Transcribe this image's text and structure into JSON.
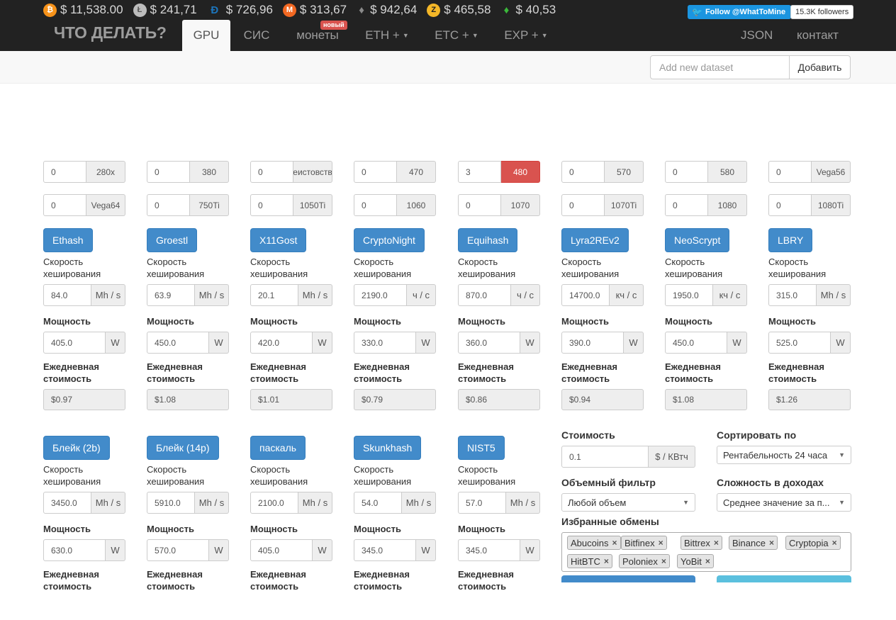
{
  "tickers": [
    {
      "icon": "bitcoin-icon",
      "cls": "btc",
      "glyph": "₿",
      "price": "$ 11,538.00"
    },
    {
      "icon": "litecoin-icon",
      "cls": "ltc",
      "glyph": "Ł",
      "price": "$ 241,71"
    },
    {
      "icon": "dash-icon",
      "cls": "dash",
      "glyph": "Đ",
      "price": "$ 726,96"
    },
    {
      "icon": "monero-icon",
      "cls": "xmr",
      "glyph": "M",
      "price": "$ 313,67"
    },
    {
      "icon": "ethereum-icon",
      "cls": "eth",
      "glyph": "♦",
      "price": "$ 942,64"
    },
    {
      "icon": "zcash-icon",
      "cls": "zec",
      "glyph": "Z",
      "price": "$ 465,58"
    },
    {
      "icon": "ethereum-classic-icon",
      "cls": "etc",
      "glyph": "♦",
      "price": "$ 40,53"
    }
  ],
  "twitter": {
    "follow_label": "Follow @WhatToMine",
    "followers": "15.3K followers"
  },
  "brand": "ЧТО ДЕЛАТЬ?",
  "nav": {
    "gpu": "GPU",
    "cis": "СИС",
    "coins": "монеты",
    "new_badge": "новый",
    "eth": "ETH +",
    "etc": "ETC +",
    "exp": "EXP +",
    "json": "JSON",
    "contact": "контакт"
  },
  "dataset": {
    "placeholder": "Add new dataset",
    "add_label": "Добавить"
  },
  "gpus": [
    {
      "name": "280x",
      "qty": "0",
      "highlight": false
    },
    {
      "name": "380",
      "qty": "0",
      "highlight": false
    },
    {
      "name": "неистовство",
      "qty": "0",
      "highlight": false
    },
    {
      "name": "470",
      "qty": "0",
      "highlight": false
    },
    {
      "name": "480",
      "qty": "3",
      "highlight": true
    },
    {
      "name": "570",
      "qty": "0",
      "highlight": false
    },
    {
      "name": "580",
      "qty": "0",
      "highlight": false
    },
    {
      "name": "Vega56",
      "qty": "0",
      "highlight": false
    },
    {
      "name": "Vega64",
      "qty": "0",
      "highlight": false
    },
    {
      "name": "750Ti",
      "qty": "0",
      "highlight": false
    },
    {
      "name": "1050Ti",
      "qty": "0",
      "highlight": false
    },
    {
      "name": "1060",
      "qty": "0",
      "highlight": false
    },
    {
      "name": "1070",
      "qty": "0",
      "highlight": false
    },
    {
      "name": "1070Ti",
      "qty": "0",
      "highlight": false
    },
    {
      "name": "1080",
      "qty": "0",
      "highlight": false
    },
    {
      "name": "1080Ti",
      "qty": "0",
      "highlight": false
    }
  ],
  "labels": {
    "hashrate_1": "Скорость",
    "hashrate_2": "хеширования",
    "power": "Мощность",
    "watt_unit": "W",
    "cost_1": "Ежедневная",
    "cost_2": "стоимость"
  },
  "algos": [
    {
      "name": "Ethash",
      "hashrate": "84.0",
      "unit": "Mh / s",
      "power": "405.0",
      "cost": "$0.97"
    },
    {
      "name": "Groestl",
      "hashrate": "63.9",
      "unit": "Mh / s",
      "power": "450.0",
      "cost": "$1.08"
    },
    {
      "name": "X11Gost",
      "hashrate": "20.1",
      "unit": "Mh / s",
      "power": "420.0",
      "cost": "$1.01"
    },
    {
      "name": "CryptoNight",
      "hashrate": "2190.0",
      "unit": "ч / с",
      "power": "330.0",
      "cost": "$0.79"
    },
    {
      "name": "Equihash",
      "hashrate": "870.0",
      "unit": "ч / с",
      "power": "360.0",
      "cost": "$0.86"
    },
    {
      "name": "Lyra2REv2",
      "hashrate": "14700.0",
      "unit": "кч / с",
      "power": "390.0",
      "cost": "$0.94"
    },
    {
      "name": "NeoScrypt",
      "hashrate": "1950.0",
      "unit": "кч / с",
      "power": "450.0",
      "cost": "$1.08"
    },
    {
      "name": "LBRY",
      "hashrate": "315.0",
      "unit": "Mh / s",
      "power": "525.0",
      "cost": "$1.26"
    },
    {
      "name": "Блейк (2b)",
      "hashrate": "3450.0",
      "unit": "Mh / s",
      "power": "630.0",
      "cost": ""
    },
    {
      "name": "Блейк (14р)",
      "hashrate": "5910.0",
      "unit": "Mh / s",
      "power": "570.0",
      "cost": ""
    },
    {
      "name": "паскаль",
      "hashrate": "2100.0",
      "unit": "Mh / s",
      "power": "405.0",
      "cost": ""
    },
    {
      "name": "Skunkhash",
      "hashrate": "54.0",
      "unit": "Mh / s",
      "power": "345.0",
      "cost": ""
    },
    {
      "name": "NIST5",
      "hashrate": "57.0",
      "unit": "Mh / s",
      "power": "345.0",
      "cost": ""
    }
  ],
  "settings": {
    "cost_label": "Стоимость",
    "cost_value": "0.1",
    "cost_unit": "$ / КВтч",
    "sort_label": "Сортировать по",
    "sort_value": "Рентабельность 24 часа",
    "volume_label": "Объемный фильтр",
    "volume_value": "Любой объем",
    "difficulty_label": "Сложность в доходах",
    "difficulty_value": "Среднее значение за п...",
    "exchanges_label": "Избранные обмены",
    "exchanges": [
      "Abucoins",
      "Bitfinex",
      "Bittrex",
      "Binance",
      "Cryptopia",
      "HitBTC",
      "Poloniex",
      "YoBit"
    ]
  },
  "colors": {
    "header_bg": "#222222",
    "primary": "#428bca",
    "danger": "#d9534f",
    "twitter": "#1b95e0",
    "info": "#5bc0de"
  }
}
